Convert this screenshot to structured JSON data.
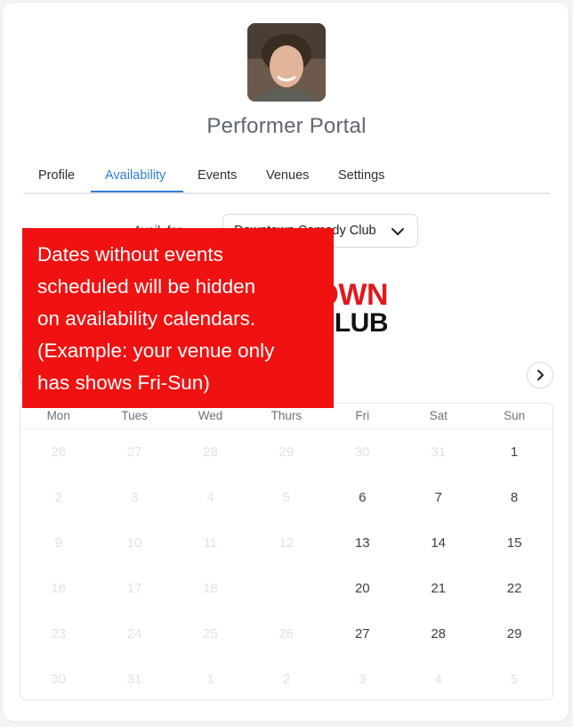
{
  "app": {
    "title": "Performer Portal"
  },
  "tabs": [
    {
      "label": "Profile"
    },
    {
      "label": "Availability",
      "active": true
    },
    {
      "label": "Events"
    },
    {
      "label": "Venues"
    },
    {
      "label": "Settings"
    }
  ],
  "venue": {
    "label": "Avail. for",
    "selected": "Downtown Comedy Club",
    "logo_line1": "OWN",
    "logo_line2": "CLUB"
  },
  "calendar": {
    "weekdays": [
      "Mon",
      "Tues",
      "Wed",
      "Thurs",
      "Fri",
      "Sat",
      "Sun"
    ],
    "weeks": [
      [
        {
          "d": "26",
          "on": false
        },
        {
          "d": "27",
          "on": false
        },
        {
          "d": "28",
          "on": false
        },
        {
          "d": "29",
          "on": false
        },
        {
          "d": "30",
          "on": false
        },
        {
          "d": "31",
          "on": false
        },
        {
          "d": "1",
          "on": true
        }
      ],
      [
        {
          "d": "2",
          "on": false
        },
        {
          "d": "3",
          "on": false
        },
        {
          "d": "4",
          "on": false
        },
        {
          "d": "5",
          "on": false
        },
        {
          "d": "6",
          "on": true
        },
        {
          "d": "7",
          "on": true
        },
        {
          "d": "8",
          "on": true
        }
      ],
      [
        {
          "d": "9",
          "on": false
        },
        {
          "d": "10",
          "on": false
        },
        {
          "d": "11",
          "on": false
        },
        {
          "d": "12",
          "on": false
        },
        {
          "d": "13",
          "on": true
        },
        {
          "d": "14",
          "on": true
        },
        {
          "d": "15",
          "on": true
        }
      ],
      [
        {
          "d": "16",
          "on": false
        },
        {
          "d": "17",
          "on": false
        },
        {
          "d": "18",
          "on": false
        },
        {
          "d": "",
          "on": false
        },
        {
          "d": "20",
          "on": true
        },
        {
          "d": "21",
          "on": true
        },
        {
          "d": "22",
          "on": true
        }
      ],
      [
        {
          "d": "23",
          "on": false
        },
        {
          "d": "24",
          "on": false
        },
        {
          "d": "25",
          "on": false
        },
        {
          "d": "26",
          "on": false
        },
        {
          "d": "27",
          "on": true
        },
        {
          "d": "28",
          "on": true
        },
        {
          "d": "29",
          "on": true
        }
      ],
      [
        {
          "d": "30",
          "on": false
        },
        {
          "d": "31",
          "on": false
        },
        {
          "d": "1",
          "on": false
        },
        {
          "d": "2",
          "on": false
        },
        {
          "d": "3",
          "on": false
        },
        {
          "d": "4",
          "on": false
        },
        {
          "d": "5",
          "on": false
        }
      ]
    ]
  },
  "overlay": {
    "lines": [
      "Dates without events",
      "scheduled will be hidden",
      "on availability calendars.",
      "(Example: your venue only",
      "has shows Fri-Sun)"
    ]
  },
  "colors": {
    "accent": "#2f7fd6",
    "overlay": "#f01111"
  },
  "icons": {
    "next": "chevron-right-icon",
    "prev": "chevron-left-icon",
    "dropdown": "chevron-down-icon"
  }
}
